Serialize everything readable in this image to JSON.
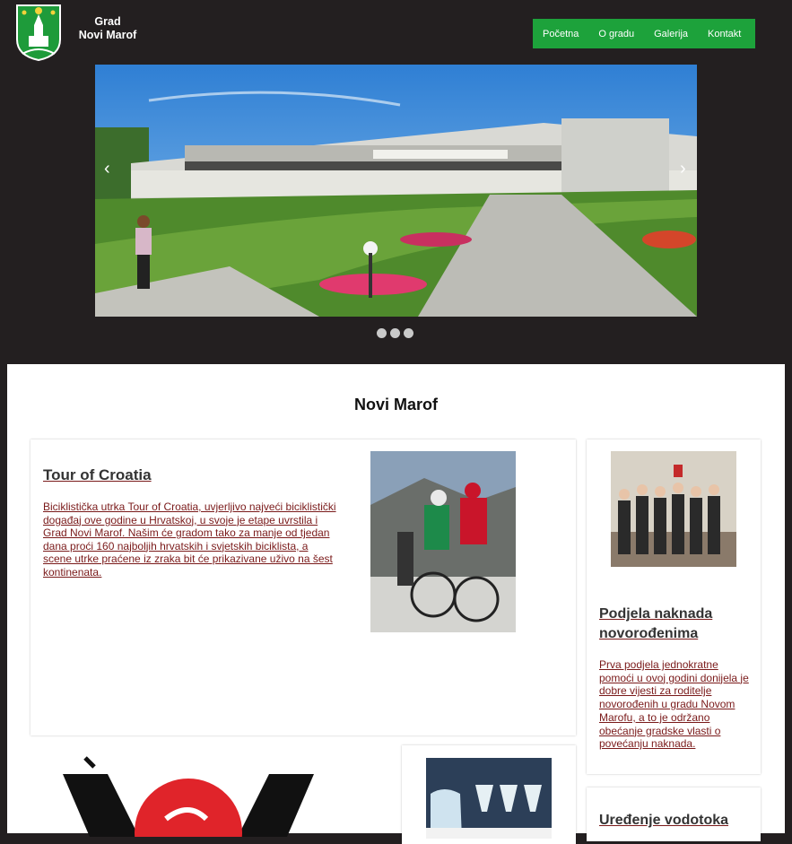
{
  "brand": {
    "line1": "Grad",
    "line2": "Novi Marof"
  },
  "nav": {
    "items": [
      "Početna",
      "O gradu",
      "Galerija",
      "Kontakt"
    ]
  },
  "carousel": {
    "prev": "‹",
    "next": "›",
    "slide_count": 3,
    "image": "kulturni-centar-photo"
  },
  "main": {
    "title": "Novi Marof",
    "articles": [
      {
        "title": "Tour of Croatia",
        "body": "Biciklistička utrka Tour of Croatia, uvjerljivo najveći biciklistički događaj ove godine u Hrvatskoj, u svoje je etape uvrstila i Grad Novi Marof. Našim će gradom tako za manje od tjedan dana proći 160 najboljih hrvatskih i svjetskih biciklista, a scene utrke praćene iz zraka bit će prikazivane uživo na šest kontinenata."
      },
      {
        "title": "Podjela naknada novorođenima",
        "body": "Prva podjela jednokratne pomoći u ovoj godini donijela je dobre vijesti za roditelje novorođenih u gradu Novom Marofu, a to je održano obećanje gradske vlasti o povećanju naknada."
      },
      {
        "title": "Uređenje vodotoka"
      }
    ]
  },
  "colors": {
    "nav_bg": "#1da23b",
    "page_bg": "#231f20",
    "link": "#7a1a1a"
  }
}
